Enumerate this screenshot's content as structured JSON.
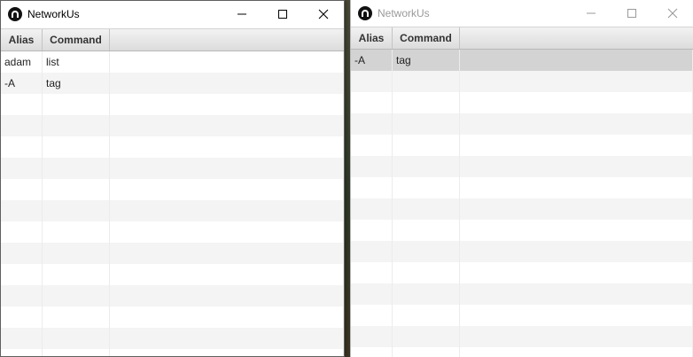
{
  "desktop": {
    "bg": "#3a3a2c"
  },
  "windows": [
    {
      "state": "active",
      "title": "NetworkUs",
      "icon": "networkus-logo-icon",
      "controls": [
        "minimize-icon",
        "maximize-icon",
        "close-icon"
      ],
      "columns": [
        "Alias",
        "Command"
      ],
      "rows": [
        {
          "alias": "adam",
          "command": "list"
        },
        {
          "alias": "-A",
          "command": "tag"
        }
      ]
    },
    {
      "state": "inactive",
      "title": "NetworkUs",
      "icon": "networkus-logo-icon",
      "controls": [
        "minimize-icon",
        "maximize-icon",
        "close-icon"
      ],
      "columns": [
        "Alias",
        "Command"
      ],
      "selected_row": 0,
      "rows": [
        {
          "alias": "-A",
          "command": "tag"
        }
      ]
    }
  ],
  "colors": {
    "selection": "#d3d3d3",
    "row_alt": "#f4f4f4",
    "header": "#e6e6e6"
  }
}
